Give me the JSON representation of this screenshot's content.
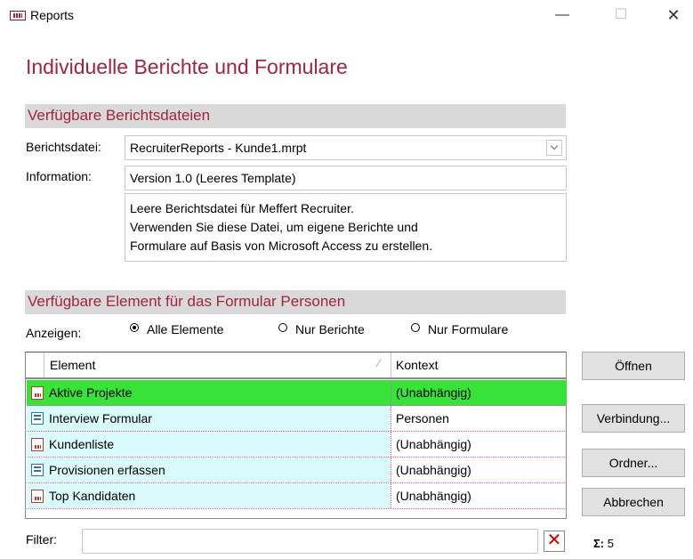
{
  "window": {
    "title": "Reports",
    "minimize": "—",
    "maximize": "☐",
    "close": "✕"
  },
  "page_title": "Individuelle Berichte und Formulare",
  "section_files": {
    "title": "Verfügbare Berichtsdateien"
  },
  "file": {
    "label": "Berichtsdatei:",
    "value": "RecruiterReports - Kunde1.mrpt",
    "info_label": "Information:",
    "info_value": "Version 1.0 (Leeres Template)",
    "description_lines": [
      "Leere Berichtsdatei für Meffert Recruiter.",
      "Verwenden Sie diese Datei, um eigene Berichte und",
      "Formulare auf Basis von Microsoft Access zu erstellen."
    ]
  },
  "section_elements": {
    "title": "Verfügbare Element für das Formular Personen"
  },
  "show": {
    "label": "Anzeigen:",
    "options": [
      {
        "label": "Alle Elemente",
        "checked": true
      },
      {
        "label": "Nur Berichte",
        "checked": false
      },
      {
        "label": "Nur Formulare",
        "checked": false
      }
    ]
  },
  "table": {
    "columns": [
      "Element",
      "Kontext"
    ],
    "rows": [
      {
        "icon": "report-icon",
        "element": "Aktive Projekte",
        "context": "(Unabhängig)",
        "selected": true
      },
      {
        "icon": "form-icon",
        "element": "Interview Formular",
        "context": "Personen",
        "selected": false
      },
      {
        "icon": "report-icon",
        "element": "Kundenliste",
        "context": "(Unabhängig)",
        "selected": false
      },
      {
        "icon": "form-icon",
        "element": "Provisionen erfassen",
        "context": "(Unabhängig)",
        "selected": false
      },
      {
        "icon": "report-icon",
        "element": "Top Kandidaten",
        "context": "(Unabhängig)",
        "selected": false
      }
    ]
  },
  "buttons": {
    "open": "Öffnen",
    "connection": "Verbindung...",
    "folder": "Ordner...",
    "cancel": "Abbrechen"
  },
  "filter": {
    "label": "Filter:",
    "value": "",
    "clear": "✕"
  },
  "count": {
    "symbol": "Σ:",
    "value": "5"
  },
  "colors": {
    "accent": "#a3243e",
    "selected_row": "#37e339",
    "row_bg": "#d9fbfb"
  }
}
